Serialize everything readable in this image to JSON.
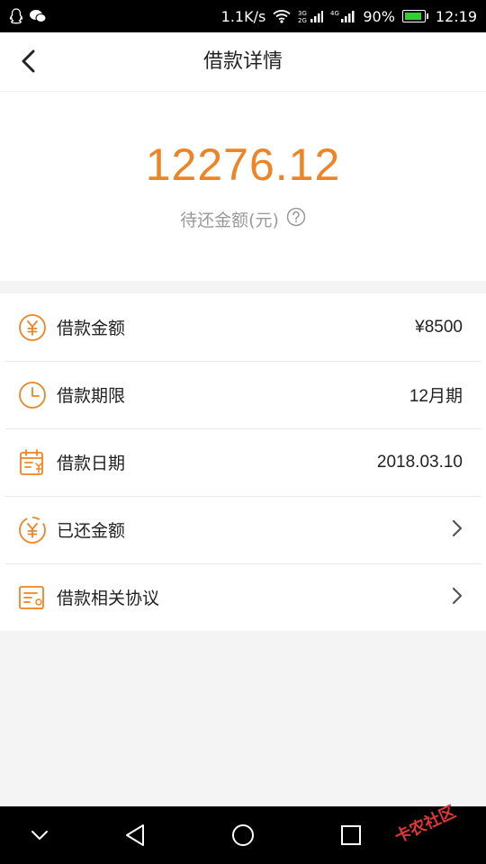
{
  "status_bar": {
    "speed": "1.1K/s",
    "battery": "90%",
    "time": "12:19"
  },
  "nav": {
    "title": "借款详情"
  },
  "summary": {
    "amount": "12276.12",
    "label": "待还金额(元)"
  },
  "details": [
    {
      "label": "借款金额",
      "value": "¥8500",
      "icon": "yuan-circle-icon"
    },
    {
      "label": "借款期限",
      "value": "12月期",
      "icon": "clock-icon"
    },
    {
      "label": "借款日期",
      "value": "2018.03.10",
      "icon": "calendar-yuan-icon"
    },
    {
      "label": "已还金额",
      "value": "",
      "icon": "yuan-dashed-circle-icon"
    },
    {
      "label": "借款相关协议",
      "value": "",
      "icon": "document-seal-icon"
    }
  ],
  "watermark": "卡农社区",
  "colors": {
    "accent": "#f08323",
    "muted": "#9a9a9a"
  }
}
